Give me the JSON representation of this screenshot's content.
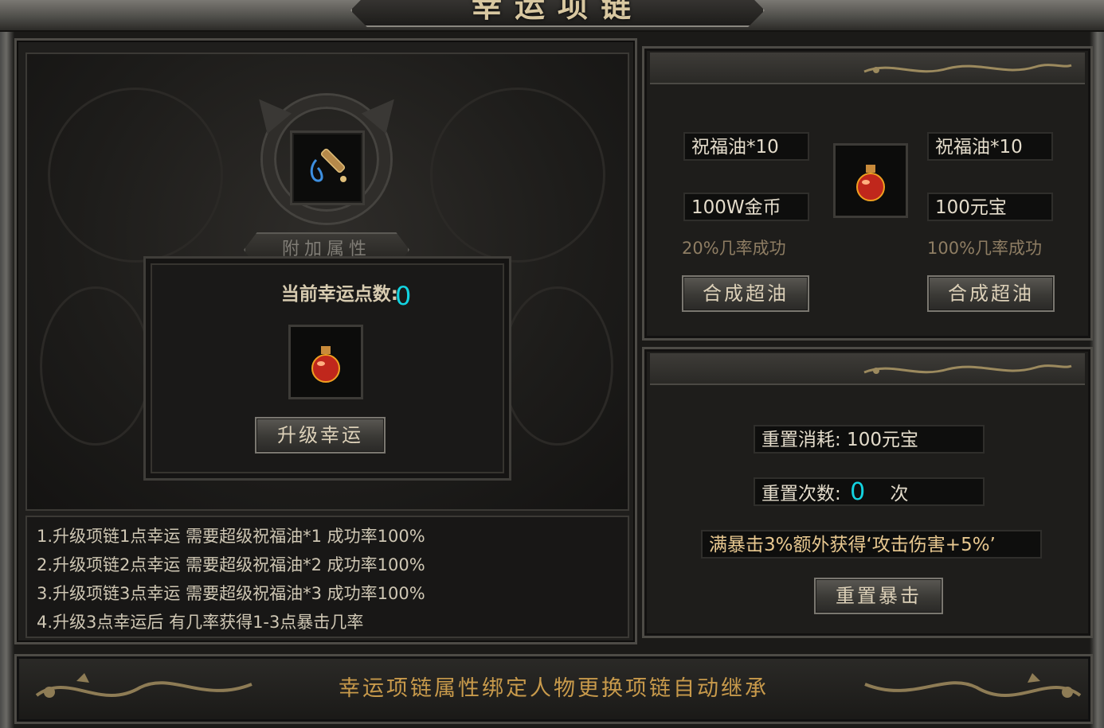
{
  "window": {
    "title": "幸运项链"
  },
  "left": {
    "attr_label": "附加属性",
    "luck_label": "当前幸运点数:",
    "luck_value": "0",
    "upgrade_button": "升级幸运",
    "rules": [
      "1.升级项链1点幸运  需要超级祝福油*1  成功率100%",
      "2.升级项链2点幸运  需要超级祝福油*2  成功率100%",
      "3.升级项链3点幸运  需要超级祝福油*3  成功率100%",
      "4.升级3点幸运后     有几率获得1-3点暴击几率"
    ]
  },
  "synth": {
    "left": {
      "material": "祝福油*10",
      "cost": "100W金币",
      "rate": "20%几率成功",
      "button": "合成超油"
    },
    "right": {
      "material": "祝福油*10",
      "cost": "100元宝",
      "rate": "100%几率成功",
      "button": "合成超油"
    }
  },
  "reset": {
    "cost_text": "重置消耗: 100元宝",
    "count_label": "重置次数:",
    "count_value": "0",
    "count_unit": "次",
    "bonus_text": "满暴击3%额外获得‘攻击伤害+5%’",
    "button": "重置暴击"
  },
  "footer": {
    "text": "幸运项链属性绑定人物更换项链自动继承"
  },
  "colors": {
    "accent_cyan": "#13d3e0",
    "gold": "#c89a4b",
    "text_light": "#dcd0b8"
  },
  "icons": {
    "necklace": "necklace-icon",
    "oil": "oil-flask-icon",
    "dragon": "dragon-ornament-icon"
  }
}
